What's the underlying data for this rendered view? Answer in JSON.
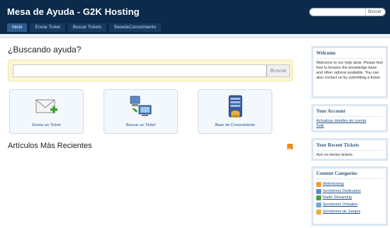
{
  "header": {
    "title": "Mesa de Ayuda - G2K Hosting",
    "search_placeholder": "",
    "search_button": "Buscar"
  },
  "nav": {
    "tabs": [
      {
        "label": "Inicio",
        "active": true
      },
      {
        "label": "Enviar Ticket",
        "active": false
      },
      {
        "label": "Buscar Tickets",
        "active": false
      },
      {
        "label": "BasedeConocimiento",
        "active": false
      }
    ]
  },
  "main": {
    "search_heading": "¿Buscando ayuda?",
    "search_value": "",
    "search_button": "Buscar",
    "actions": [
      {
        "label": "Enviar un Ticket",
        "icon": "envelope-add-icon"
      },
      {
        "label": "Buscar un Ticket",
        "icon": "computer-network-icon"
      },
      {
        "label": "Base de Conocimiento",
        "icon": "server-database-icon"
      }
    ],
    "articles_title": "Artículos Más Recientes"
  },
  "sidebar": {
    "welcome": {
      "title": "Welcome",
      "text": "Welcome to our help desk. Please feel free to browse the knowledge base and other options available. You can also contact us by submitting a ticket."
    },
    "account": {
      "title": "Your Account",
      "links": [
        "Actualizar detalles de cuenta",
        "Salir"
      ]
    },
    "tickets": {
      "title": "Your Recent Tickets",
      "text": "Aún no tienes tickets."
    },
    "categories": {
      "title": "Content Categories",
      "items": [
        {
          "label": "WebHosting",
          "color": "#f0a030"
        },
        {
          "label": "Servidores Dedicados",
          "color": "#5a8ac8"
        },
        {
          "label": "Radio Streaming",
          "color": "#4aa040"
        },
        {
          "label": "Servidores Virtuales",
          "color": "#6aa8e0"
        },
        {
          "label": "Servidores de Juegos",
          "color": "#e8b040"
        }
      ]
    }
  },
  "colors": {
    "header_bg": "#0c2a4a",
    "nav_active": "#2a5b8d",
    "link": "#1e4f8a",
    "search_panel_bg": "#fbf7d2"
  }
}
